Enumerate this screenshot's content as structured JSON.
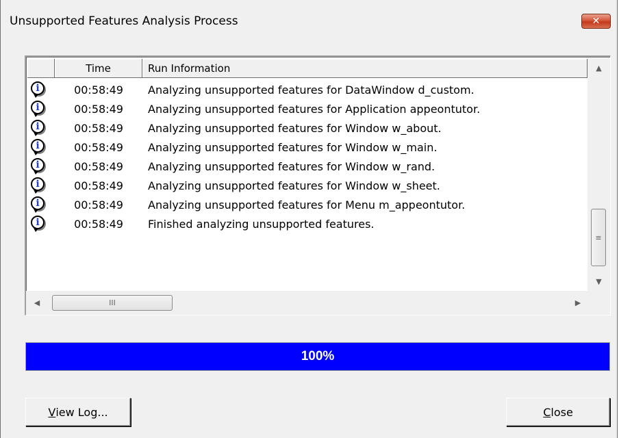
{
  "window": {
    "title": "Unsupported Features Analysis Process",
    "close_glyph": "✕"
  },
  "listview": {
    "columns": [
      "",
      "Time",
      "Run Information"
    ],
    "rows": [
      {
        "icon": "info-icon",
        "time": "00:58:49",
        "info": "Analyzing unsupported features for DataWindow d_custom."
      },
      {
        "icon": "info-icon",
        "time": "00:58:49",
        "info": "Analyzing unsupported features for Application appeontutor."
      },
      {
        "icon": "info-icon",
        "time": "00:58:49",
        "info": "Analyzing unsupported features for Window w_about."
      },
      {
        "icon": "info-icon",
        "time": "00:58:49",
        "info": "Analyzing unsupported features for Window w_main."
      },
      {
        "icon": "info-icon",
        "time": "00:58:49",
        "info": "Analyzing unsupported features for Window w_rand."
      },
      {
        "icon": "info-icon",
        "time": "00:58:49",
        "info": "Analyzing unsupported features for Window w_sheet."
      },
      {
        "icon": "info-icon",
        "time": "00:58:49",
        "info": "Analyzing unsupported features for Menu m_appeontutor."
      },
      {
        "icon": "info-icon",
        "time": "00:58:49",
        "info": "Finished analyzing unsupported features."
      }
    ],
    "scroll": {
      "up": "▲",
      "down": "▼",
      "left": "◀",
      "right": "▶",
      "v_grip": "≡",
      "h_grip": "III"
    }
  },
  "progress": {
    "percent": 100,
    "label": "100%",
    "fill_color": "#0000ff"
  },
  "buttons": {
    "view_log": {
      "accel": "V",
      "rest": "iew Log..."
    },
    "close": {
      "accel": "C",
      "rest": "lose"
    }
  }
}
